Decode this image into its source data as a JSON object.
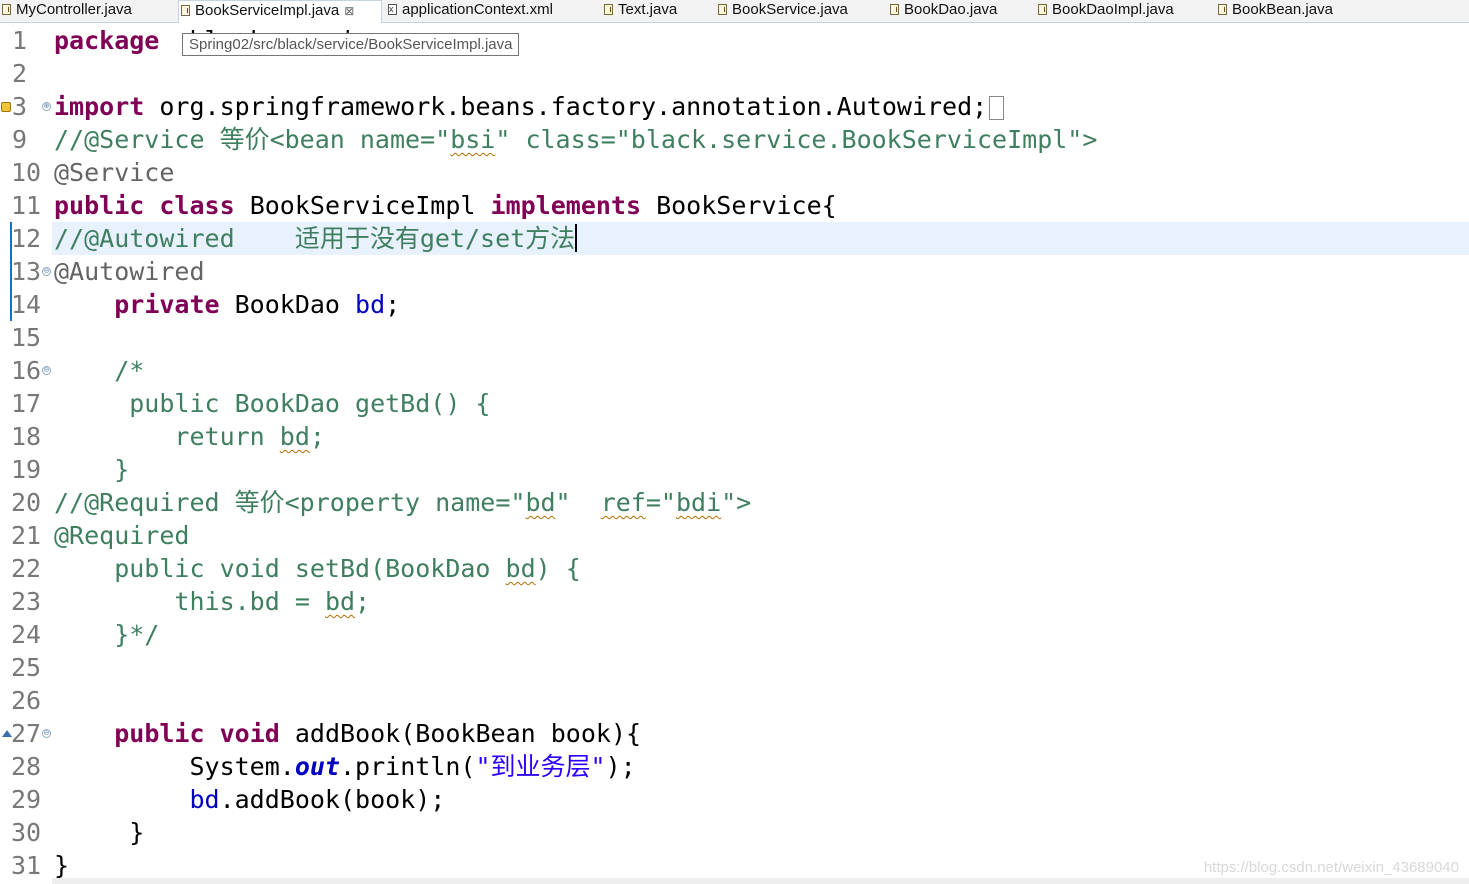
{
  "tabs": [
    {
      "label": "MyController.java",
      "type": "java"
    },
    {
      "label": "BookServiceImpl.java",
      "type": "java",
      "active": true,
      "close": "⊠"
    },
    {
      "label": "applicationContext.xml",
      "type": "xml"
    },
    {
      "label": "Text.java",
      "type": "java"
    },
    {
      "label": "BookService.java",
      "type": "java"
    },
    {
      "label": "BookDao.java",
      "type": "java"
    },
    {
      "label": "BookDaoImpl.java",
      "type": "java"
    },
    {
      "label": "BookBean.java",
      "type": "java"
    }
  ],
  "tooltip": "Spring02/src/black/service/BookServiceImpl.java",
  "lines": [
    {
      "n": "1",
      "segs": [
        [
          "kw",
          "package"
        ],
        [
          "",
          "  "
        ],
        [
          "",
          "black.service;"
        ]
      ]
    },
    {
      "n": "2",
      "segs": []
    },
    {
      "n": "3",
      "fold": "⊕",
      "segs": [
        [
          "kw",
          "import"
        ],
        [
          "",
          " org.springframework.beans.factory.annotation.Autowired;"
        ],
        [
          "box",
          ""
        ]
      ]
    },
    {
      "n": "9",
      "segs": [
        [
          "cm",
          "//@Service 等价<bean name=\""
        ],
        [
          "cm sq",
          "bsi"
        ],
        [
          "cm",
          "\" class=\"black.service.BookServiceImpl\">"
        ]
      ]
    },
    {
      "n": "10",
      "segs": [
        [
          "an",
          "@Service"
        ]
      ]
    },
    {
      "n": "11",
      "segs": [
        [
          "kw",
          "public"
        ],
        [
          "",
          " "
        ],
        [
          "kw",
          "class"
        ],
        [
          "",
          " BookServiceImpl "
        ],
        [
          "kw",
          "implements"
        ],
        [
          "",
          " BookService{"
        ]
      ]
    },
    {
      "n": "12",
      "segs": [
        [
          "cm",
          "//@Autowired    适用于没有get/set方法"
        ],
        [
          "caret",
          ""
        ]
      ]
    },
    {
      "n": "13",
      "fold": "⊖",
      "segs": [
        [
          "an",
          "@Autowired"
        ]
      ]
    },
    {
      "n": "14",
      "segs": [
        [
          "",
          "    "
        ],
        [
          "kw",
          "private"
        ],
        [
          "",
          " BookDao "
        ],
        [
          "fd",
          "bd"
        ],
        [
          "",
          ";"
        ]
      ]
    },
    {
      "n": "15",
      "segs": []
    },
    {
      "n": "16",
      "fold": "⊖",
      "segs": [
        [
          "cm",
          "    /*"
        ]
      ]
    },
    {
      "n": "17",
      "segs": [
        [
          "cm",
          "     public BookDao getBd() {"
        ]
      ]
    },
    {
      "n": "18",
      "segs": [
        [
          "cm",
          "        return "
        ],
        [
          "cm sq",
          "bd"
        ],
        [
          "cm",
          ";"
        ]
      ]
    },
    {
      "n": "19",
      "segs": [
        [
          "cm",
          "    }"
        ]
      ]
    },
    {
      "n": "20",
      "segs": [
        [
          "cm",
          "//@Required 等价<property name=\""
        ],
        [
          "cm sq",
          "bd"
        ],
        [
          "cm",
          "\"  "
        ],
        [
          "cm sq",
          "ref"
        ],
        [
          "cm",
          "=\""
        ],
        [
          "cm sq",
          "bdi"
        ],
        [
          "cm",
          "\">"
        ]
      ]
    },
    {
      "n": "21",
      "segs": [
        [
          "cm",
          "@Required"
        ]
      ]
    },
    {
      "n": "22",
      "segs": [
        [
          "cm",
          "    public void setBd(BookDao "
        ],
        [
          "cm sq",
          "bd"
        ],
        [
          "cm",
          ") {"
        ]
      ]
    },
    {
      "n": "23",
      "segs": [
        [
          "cm",
          "        this.bd = "
        ],
        [
          "cm sq",
          "bd"
        ],
        [
          "cm",
          ";"
        ]
      ]
    },
    {
      "n": "24",
      "segs": [
        [
          "cm",
          "    }*/"
        ]
      ]
    },
    {
      "n": "25",
      "segs": []
    },
    {
      "n": "26",
      "segs": []
    },
    {
      "n": "27",
      "fold": "⊖",
      "segs": [
        [
          "",
          "    "
        ],
        [
          "kw",
          "public"
        ],
        [
          "",
          " "
        ],
        [
          "kw",
          "void"
        ],
        [
          "",
          " addBook(BookBean book){"
        ]
      ]
    },
    {
      "n": "28",
      "segs": [
        [
          "",
          "         System."
        ],
        [
          "fdi",
          "out"
        ],
        [
          "",
          ".println("
        ],
        [
          "st",
          "\"到业务层\""
        ],
        [
          "",
          ");"
        ]
      ]
    },
    {
      "n": "29",
      "segs": [
        [
          "",
          "         "
        ],
        [
          "fd",
          "bd"
        ],
        [
          "",
          ".addBook(book);"
        ]
      ]
    },
    {
      "n": "30",
      "segs": [
        [
          "",
          "     }"
        ]
      ]
    },
    {
      "n": "31",
      "segs": [
        [
          "",
          "}"
        ]
      ]
    }
  ],
  "watermark": "https://blog.csdn.net/weixin_43689040"
}
